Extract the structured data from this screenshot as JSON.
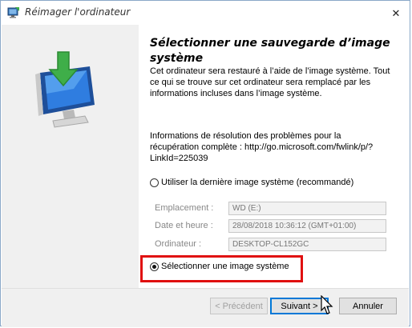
{
  "window": {
    "title": "Réimager l'ordinateur",
    "close_glyph": "✕",
    "icons": [
      "app-monitor-icon",
      "close-icon",
      "backup-monitor-arrow-icon"
    ]
  },
  "main": {
    "heading": "Sélectionner une sauvegarde d’image système",
    "description": "Cet ordinateur sera restauré à l’aide de l’image système. Tout ce qui se trouve sur cet ordinateur sera remplacé par les informations incluses dans l’image système.",
    "info": "Informations de résolution des problèmes pour la récupération complète : http://go.microsoft.com/fwlink/p/?LinkId=225039",
    "option_latest": {
      "label": "Utiliser la dernière image système (recommandé)",
      "checked": false
    },
    "fields": [
      {
        "label": "Emplacement :",
        "value": "WD (E:)"
      },
      {
        "label": "Date et heure :",
        "value": "28/08/2018 10:36:12 (GMT+01:00)"
      },
      {
        "label": "Ordinateur :",
        "value": "DESKTOP-CL152GC"
      }
    ],
    "option_select": {
      "label": "Sélectionner une image système",
      "checked": true
    },
    "highlight_color": "#e01010"
  },
  "buttons": {
    "previous": "< Précédent",
    "next": "Suivant >",
    "cancel": "Annuler"
  },
  "colors": {
    "accent": "#0078d7",
    "left_pane": "#f0f0f0"
  }
}
